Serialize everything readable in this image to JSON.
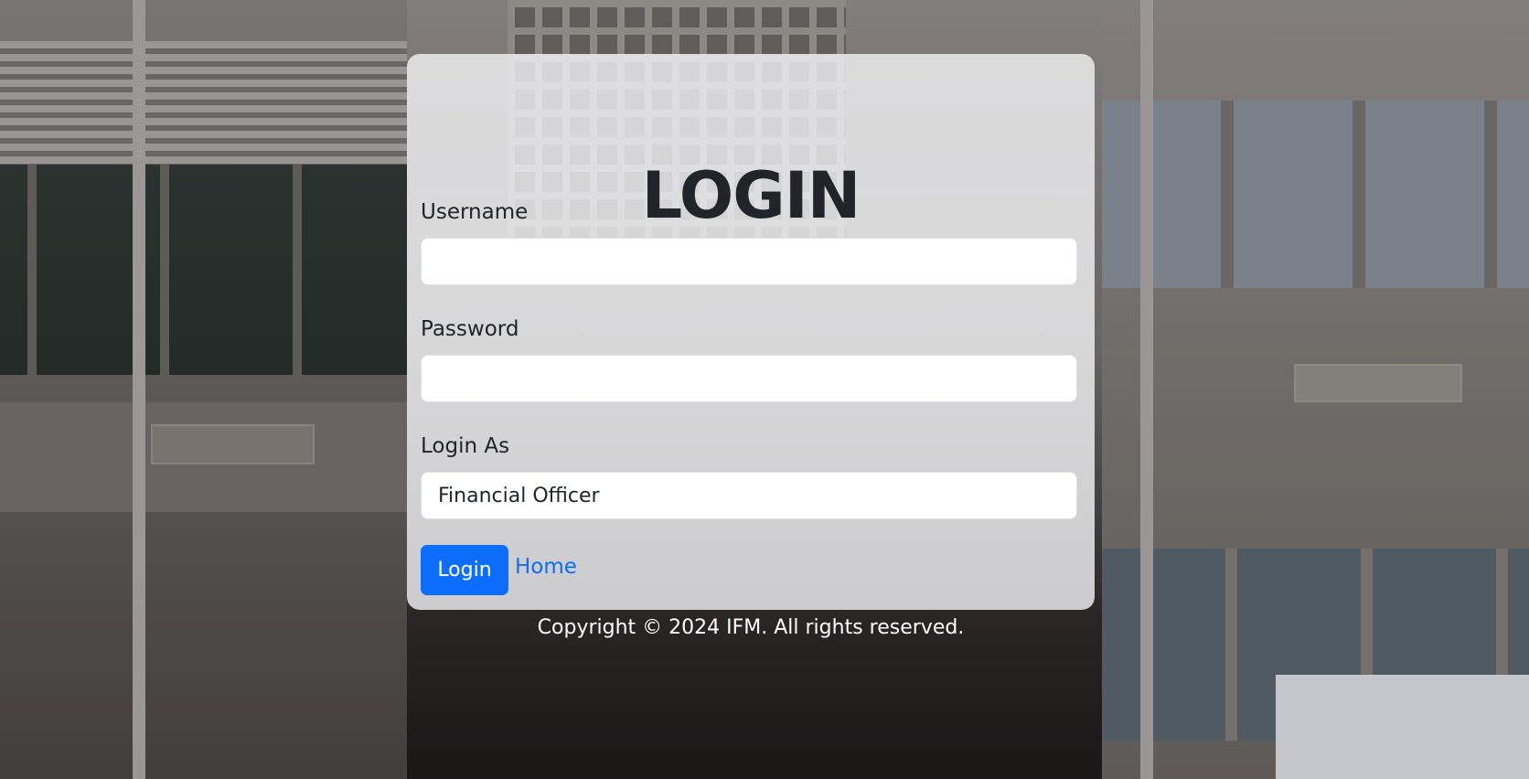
{
  "login": {
    "title": "LOGIN",
    "username_label": "Username",
    "username_value": "",
    "password_label": "Password",
    "password_value": "",
    "login_as_label": "Login As",
    "login_as_selected": "Financial Officer",
    "login_button": "Login",
    "home_link": "Home"
  },
  "footer": {
    "copyright": "Copyright © 2024 IFM. All rights reserved."
  },
  "colors": {
    "primary": "#0d6efd",
    "text": "#212529"
  }
}
